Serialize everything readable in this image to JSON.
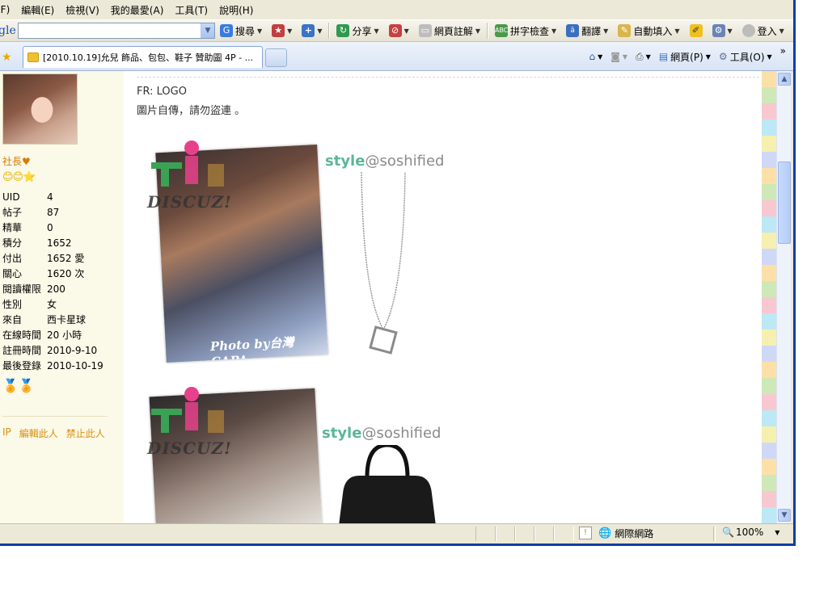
{
  "menu": {
    "items": [
      "(F)",
      "編輯(E)",
      "檢視(V)",
      "我的最愛(A)",
      "工具(T)",
      "說明(H)"
    ]
  },
  "google_toolbar": {
    "logo_text": "gle",
    "search_value": "",
    "search_label": "搜尋",
    "share_label": "分享",
    "annotate_label": "網頁註解",
    "spell_label": "拼字檢查",
    "translate_label": "翻譯",
    "autofill_label": "自動填入",
    "login_label": "登入"
  },
  "tab": {
    "title": "[2010.10.19]允兒 飾品、包包、鞋子 贊助圖 4P - ..."
  },
  "command_bar": {
    "page_label": "網頁(P)",
    "tools_label": "工具(O)",
    "chevron": "»"
  },
  "sidebar": {
    "username": "社長♥",
    "stars": "😊😊⭐",
    "stats": [
      {
        "k": "UID",
        "v": "4"
      },
      {
        "k": "帖子",
        "v": "87"
      },
      {
        "k": "精華",
        "v": "0"
      },
      {
        "k": "積分",
        "v": "1652"
      },
      {
        "k": "付出",
        "v": "1652 愛"
      },
      {
        "k": "關心",
        "v": "1620 次"
      },
      {
        "k": "閱讀權限",
        "v": "200"
      },
      {
        "k": "性別",
        "v": "女"
      },
      {
        "k": "來自",
        "v": "西卡星球"
      },
      {
        "k": "在線時間",
        "v": "20 小時"
      },
      {
        "k": "註冊時間",
        "v": "2010-9-10"
      },
      {
        "k": "最後登錄",
        "v": "2010-10-19"
      }
    ],
    "actions": [
      "IP",
      "編輯此人",
      "禁止此人"
    ]
  },
  "post": {
    "line1": "FR: LOGO",
    "line2": "圖片自傳，請勿盜連 。",
    "watermark": "DISCUZ!",
    "photo_caption": "Photo by台灣CAPA",
    "style_brand": "style",
    "style_site": "@soshified"
  },
  "status": {
    "zone": "網際網路",
    "zoom": "100%"
  },
  "colors": {
    "accent": "#0a3ea8",
    "sidebar_bg": "#fbf9e8",
    "link": "#d9900a"
  }
}
